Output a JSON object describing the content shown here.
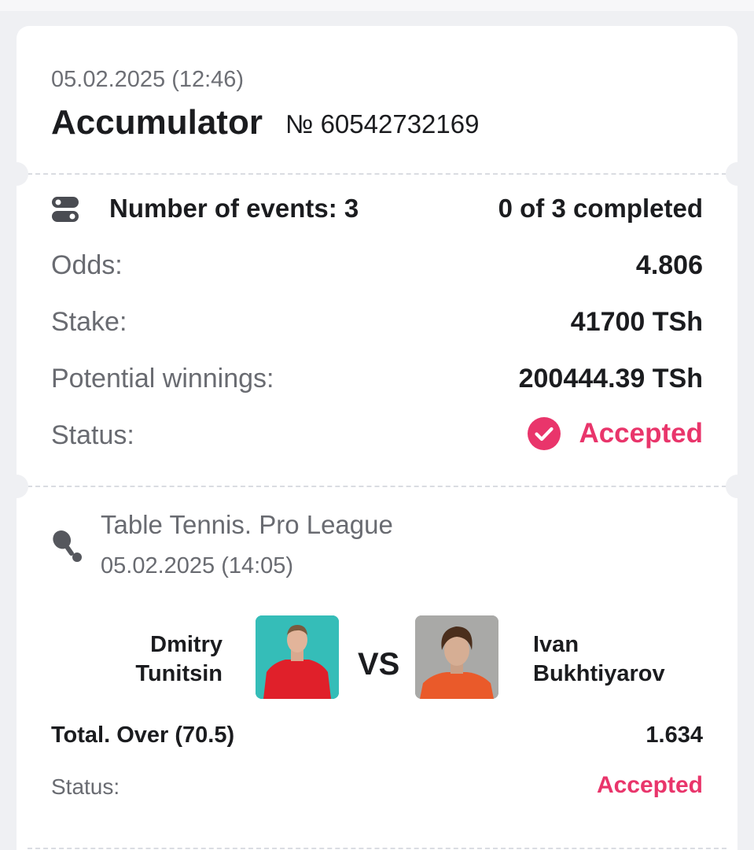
{
  "header": {
    "date": "05.02.2025 (12:46)",
    "title": "Accumulator",
    "number": "№ 60542732169"
  },
  "summary": {
    "events_label": "Number of events: 3",
    "completed": "0 of 3 completed",
    "odds_label": "Odds:",
    "odds_value": "4.806",
    "stake_label": "Stake:",
    "stake_value": "41700 TSh",
    "winnings_label": "Potential winnings:",
    "winnings_value": "200444.39 TSh",
    "status_label": "Status:",
    "status_value": "Accepted"
  },
  "event": {
    "league": "Table Tennis. Pro League",
    "date": "05.02.2025 (14:05)",
    "team1": "Dmitry Tunitsin",
    "team2": "Ivan Bukhtiyarov",
    "vs": "VS",
    "market": "Total. Over (70.5)",
    "market_odds": "1.634",
    "status_label": "Status:",
    "status_value": "Accepted"
  },
  "icons": {
    "events": "list-toggle-icon",
    "status": "check-circle-icon",
    "sport": "table-tennis-icon"
  },
  "colors": {
    "accent": "#e9356b",
    "background": "#eff0f3",
    "card": "#ffffff"
  }
}
